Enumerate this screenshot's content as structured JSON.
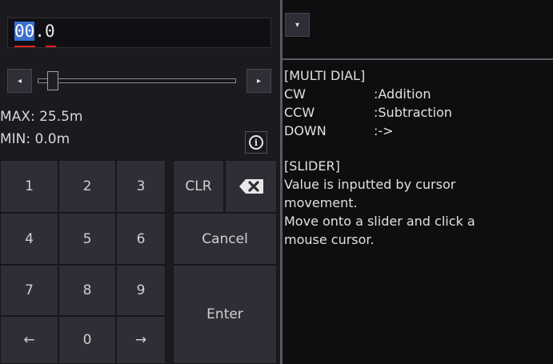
{
  "input": {
    "value_selected": "00",
    "value_rest": ".0"
  },
  "slider": {
    "left_arrow": "◂",
    "right_arrow": "▸",
    "level": 0.05
  },
  "limits": {
    "max_label": "MAX: 25.5m",
    "min_label": "MIN: 0.0m",
    "info_icon": "info-icon"
  },
  "keypad": {
    "k1": "1",
    "k2": "2",
    "k3": "3",
    "k4": "4",
    "k5": "5",
    "k6": "6",
    "k7": "7",
    "k8": "8",
    "k9": "9",
    "left": "←",
    "k0": "0",
    "right": "→",
    "clr": "CLR",
    "backspace_icon": "backspace-icon",
    "cancel": "Cancel",
    "enter": "Enter"
  },
  "dropdown": {
    "arrow": "▾"
  },
  "help": {
    "multi_dial_title": "[MULTI DIAL]",
    "cw_key": "CW",
    "cw_val": ":Addition",
    "ccw_key": "CCW",
    "ccw_val": ":Subtraction",
    "down_key": "DOWN",
    "down_val": ":->",
    "slider_title": "[SLIDER]",
    "slider_line1": "Value is inputted by cursor",
    "slider_line2": "movement.",
    "slider_line3": "Move onto a slider and click a",
    "slider_line4": "mouse cursor."
  },
  "colors": {
    "selection": "#3a6fd0",
    "underline": "#e02020",
    "key_bg": "#2e2f36"
  }
}
